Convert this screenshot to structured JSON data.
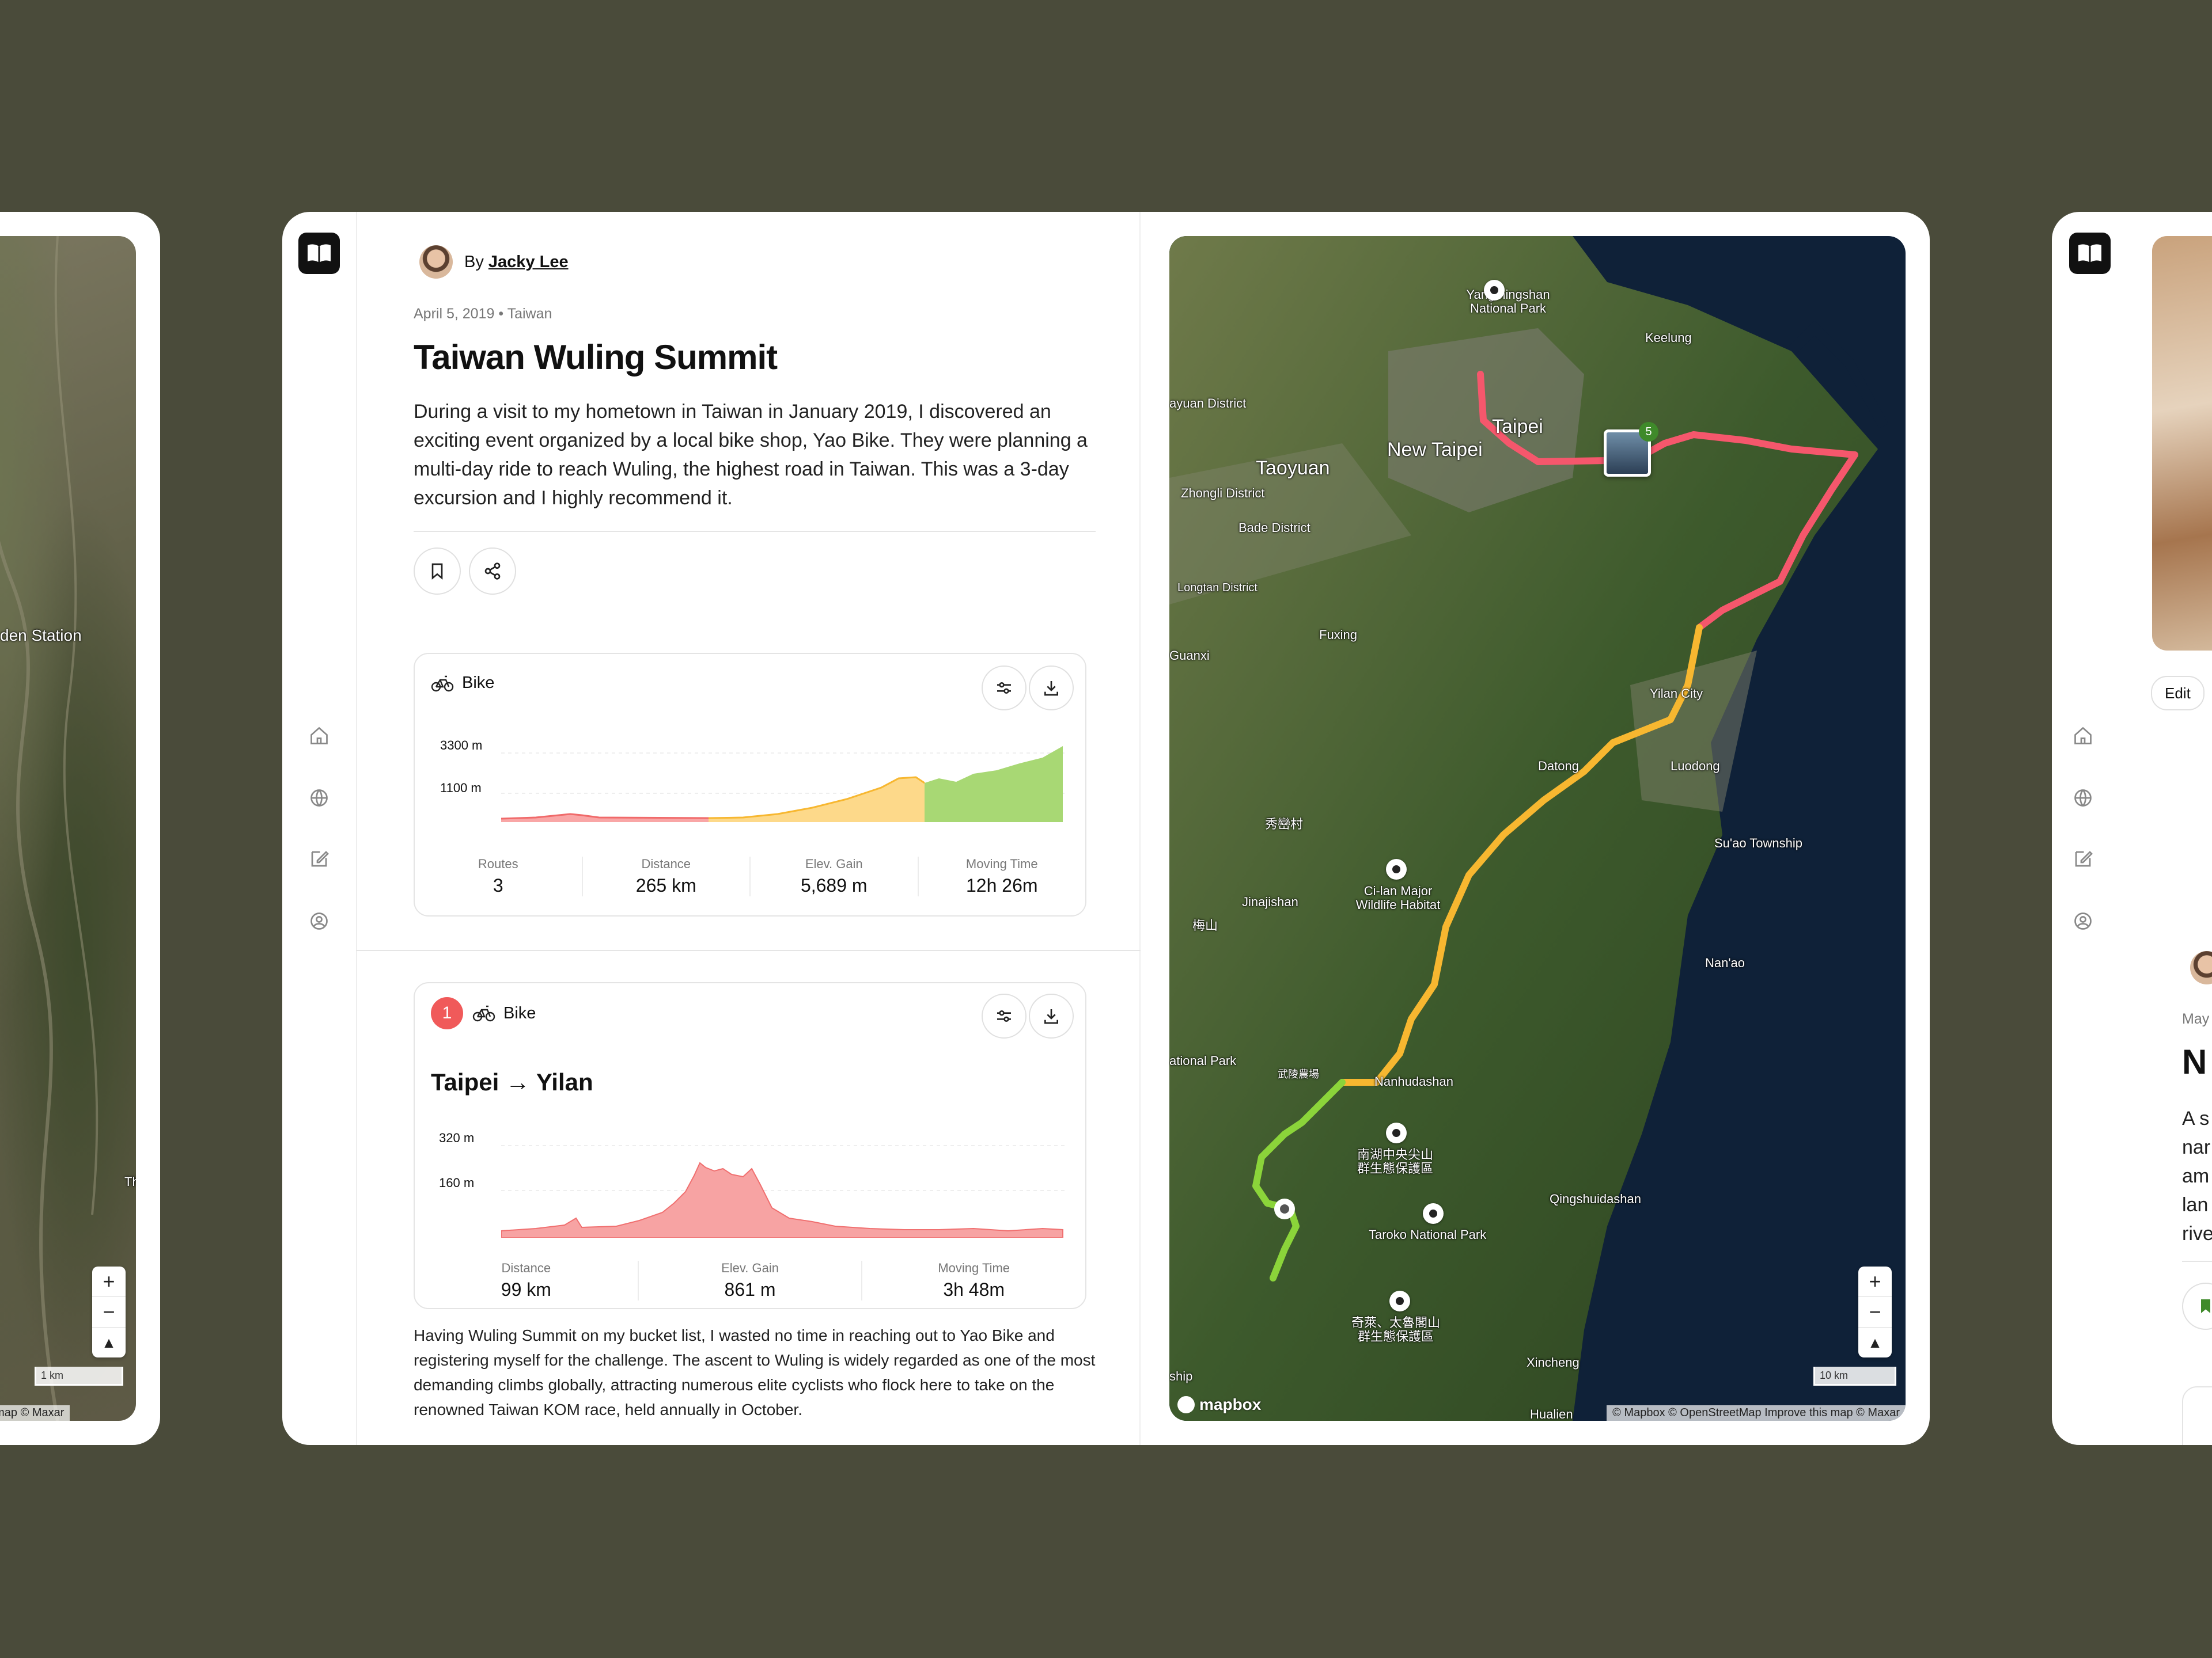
{
  "left_card": {
    "map_label": "den Station",
    "map_label_2": "Th",
    "scale_label": "1 km",
    "attribution": "rove this map © Maxar",
    "zoom_in": "+",
    "zoom_out": "−",
    "compass": "▲"
  },
  "rail": {
    "items": [
      "home",
      "globe",
      "edit",
      "profile"
    ]
  },
  "article": {
    "author_prefix": "By",
    "author_name": "Jacky Lee",
    "date": "April 5, 2019",
    "separator": "•",
    "location": "Taiwan",
    "title": "Taiwan Wuling Summit",
    "intro": "During a visit to my hometown in Taiwan in January 2019, I discovered an exciting event organized by a local bike shop, Yao Bike. They were planning a multi-day ride to reach Wuling, the highest road in Taiwan. This was a 3-day excursion and I highly recommend it.",
    "body": "Having Wuling Summit on my bucket list, I wasted no time in reaching out to Yao Bike and registering myself for the challenge. The ascent to Wuling is widely regarded as one of the most demanding climbs globally, attracting numerous elite cyclists who flock here to take on the renowned Taiwan KOM race, held annually in October."
  },
  "summary_panel": {
    "activity": "Bike",
    "y_labels": [
      "3300 m",
      "1100 m"
    ],
    "stats": [
      {
        "label": "Routes",
        "value": "3"
      },
      {
        "label": "Distance",
        "value": "265 km"
      },
      {
        "label": "Elev. Gain",
        "value": "5,689 m"
      },
      {
        "label": "Moving Time",
        "value": "12h 26m"
      }
    ]
  },
  "segment_panel": {
    "index": "1",
    "activity": "Bike",
    "title": "Taipei → Yilan",
    "y_labels": [
      "320 m",
      "160 m"
    ],
    "stats": [
      {
        "label": "Distance",
        "value": "99 km"
      },
      {
        "label": "Elev. Gain",
        "value": "861 m"
      },
      {
        "label": "Moving Time",
        "value": "3h 48m"
      }
    ]
  },
  "colors": {
    "segment1": "#f06a6a",
    "segment2": "#fbbf3a",
    "segment3": "#8acd3a",
    "badge": "#3f8a2a"
  },
  "main_map": {
    "labels": [
      {
        "text": "Yangmingshan National Park",
        "size": "small"
      },
      {
        "text": "Keelung",
        "size": "small"
      },
      {
        "text": "Taipei",
        "size": "big"
      },
      {
        "text": "New Taipei",
        "size": "big"
      },
      {
        "text": "Taoyuan",
        "size": "big"
      },
      {
        "text": "ayuan District",
        "size": "small"
      },
      {
        "text": "Zhongli District",
        "size": "small"
      },
      {
        "text": "Bade District",
        "size": "small"
      },
      {
        "text": "Longtan District",
        "size": "small"
      },
      {
        "text": "Fuxing",
        "size": "small"
      },
      {
        "text": "Guanxi",
        "size": "small"
      },
      {
        "text": "Yilan City",
        "size": "small"
      },
      {
        "text": "Datong",
        "size": "small"
      },
      {
        "text": "Luodong",
        "size": "small"
      },
      {
        "text": "Su'ao Township",
        "size": "small"
      },
      {
        "text": "秀巒村",
        "size": "small"
      },
      {
        "text": "Ci-lan Major Wildlife Habitat",
        "size": "small"
      },
      {
        "text": "Jinajishan",
        "size": "small"
      },
      {
        "text": "Nan'ao",
        "size": "small"
      },
      {
        "text": "ational Park",
        "size": "small"
      },
      {
        "text": "武陵農場",
        "size": "small"
      },
      {
        "text": "Nanhudashan",
        "size": "small"
      },
      {
        "text": "南湖中央尖山 群生態保護區",
        "size": "small"
      },
      {
        "text": "Qingshuidashan",
        "size": "small"
      },
      {
        "text": "Taroko National Park",
        "size": "small"
      },
      {
        "text": "奇萊、太魯閣山 群生態保護區",
        "size": "small"
      },
      {
        "text": "Xincheng",
        "size": "small"
      },
      {
        "text": "Hualien",
        "size": "small"
      },
      {
        "text": "ship",
        "size": "small"
      },
      {
        "text": "梅山",
        "size": "small"
      }
    ],
    "photo_count": "5",
    "scale_label": "10 km",
    "logo": "mapbox",
    "attribution": "© Mapbox © OpenStreetMap  Improve this map © Maxar",
    "zoom_in": "+",
    "zoom_out": "−",
    "compass": "▲"
  },
  "right_card": {
    "edit_label": "Edit",
    "date_fragment": "May",
    "title_fragment": "N",
    "text_lines": [
      "A s",
      "nar",
      "am",
      "lan",
      "rive"
    ]
  }
}
